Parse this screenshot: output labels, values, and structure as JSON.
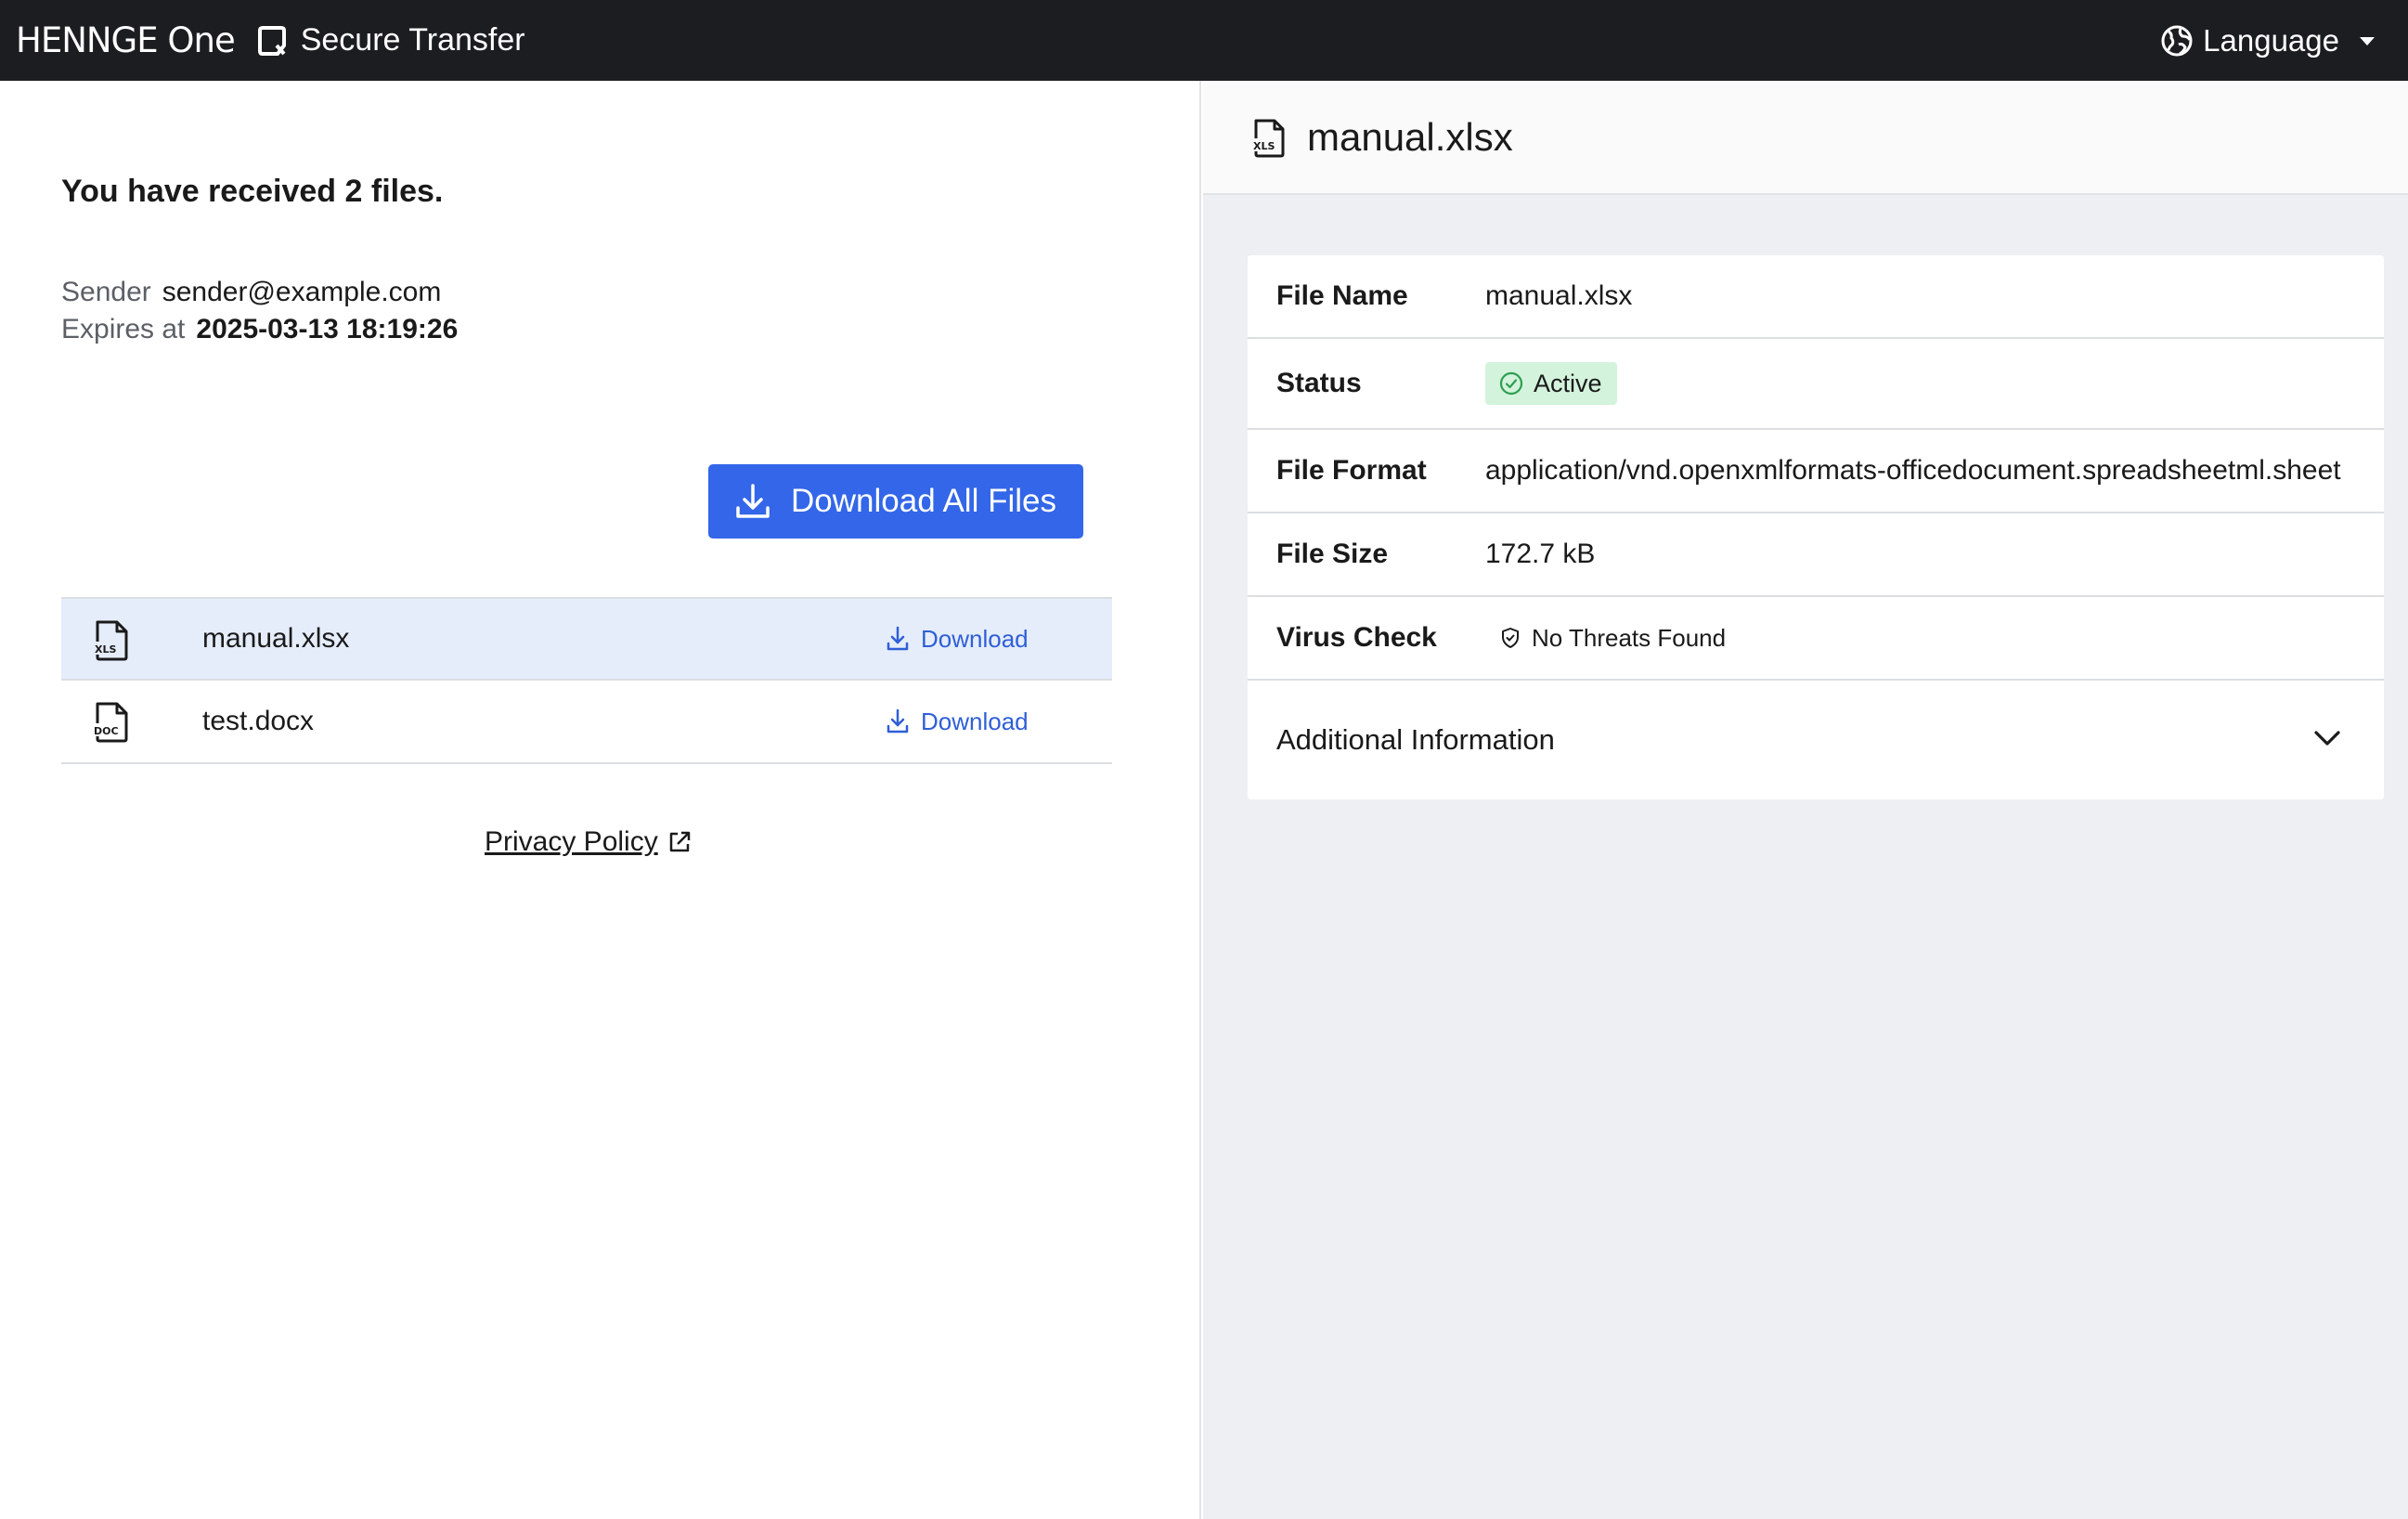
{
  "header": {
    "brand": "HENNGE One",
    "product_name": "Secure Transfer",
    "language_label": "Language"
  },
  "summary": {
    "received_text": "You have received 2 files.",
    "sender_label": "Sender",
    "sender_value": "sender@example.com",
    "expires_label": "Expires at",
    "expires_value": "2025-03-13 18:19:26"
  },
  "download_all_label": "Download All Files",
  "files": [
    {
      "name": "manual.xlsx",
      "icon": "xls-file-icon",
      "icon_text": "XLS",
      "download_label": "Download",
      "selected": true
    },
    {
      "name": "test.docx",
      "icon": "doc-file-icon",
      "icon_text": "DOC",
      "download_label": "Download",
      "selected": false
    }
  ],
  "privacy_label": "Privacy Policy",
  "detail": {
    "title": "manual.xlsx",
    "icon_text": "XLS",
    "rows": {
      "file_name": {
        "label": "File Name",
        "value": "manual.xlsx"
      },
      "status": {
        "label": "Status",
        "value": "Active"
      },
      "file_format": {
        "label": "File Format",
        "value": "application/vnd.openxmlformats-officedocument.spreadsheetml.sheet"
      },
      "file_size": {
        "label": "File Size",
        "value": "172.7 kB"
      },
      "virus_check": {
        "label": "Virus Check",
        "value": "No Threats Found"
      }
    },
    "additional_label": "Additional Information"
  },
  "colors": {
    "topbar": "#1c1d21",
    "accent": "#3366e8",
    "link": "#2f5fd6",
    "selected_row": "#e5edfb",
    "status_active_bg": "#d3f3dc",
    "status_active_icon": "#2e9e50"
  }
}
